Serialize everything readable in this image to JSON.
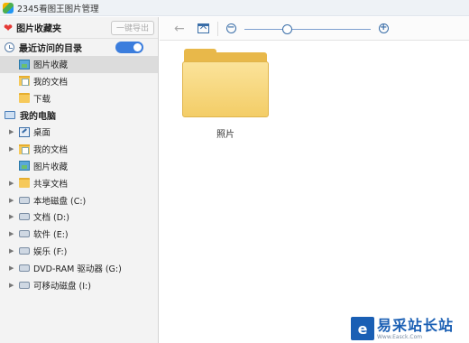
{
  "window": {
    "title": "2345看图王图片管理"
  },
  "sidebar": {
    "favorites_title": "图片收藏夹",
    "export_button": "一键导出",
    "recent_section": "最近访问的目录",
    "recent_toggle_on": true,
    "recent_items": [
      {
        "label": "图片收藏",
        "icon": "pictures-folder-icon",
        "selected": true
      },
      {
        "label": "我的文档",
        "icon": "documents-folder-icon"
      },
      {
        "label": "下载",
        "icon": "folder-icon"
      }
    ],
    "computer_section": "我的电脑",
    "computer_items": [
      {
        "label": "桌面",
        "icon": "desktop-icon",
        "expandable": true
      },
      {
        "label": "我的文档",
        "icon": "documents-folder-icon",
        "expandable": true
      },
      {
        "label": "图片收藏",
        "icon": "pictures-folder-icon",
        "expandable": false
      },
      {
        "label": "共享文档",
        "icon": "folder-icon",
        "expandable": true
      },
      {
        "label": "本地磁盘 (C:)",
        "icon": "drive-icon",
        "expandable": true
      },
      {
        "label": "文档 (D:)",
        "icon": "drive-icon",
        "expandable": true
      },
      {
        "label": "软件 (E:)",
        "icon": "drive-icon",
        "expandable": true
      },
      {
        "label": "娱乐 (F:)",
        "icon": "drive-icon",
        "expandable": true
      },
      {
        "label": "DVD-RAM 驱动器 (G:)",
        "icon": "dvd-drive-icon",
        "expandable": true
      },
      {
        "label": "可移动磁盘 (I:)",
        "icon": "drive-icon",
        "expandable": true
      }
    ]
  },
  "toolbar": {
    "back_icon": "back-arrow-icon",
    "up_icon": "up-folder-icon",
    "zoom_out": "−",
    "zoom_in": "+",
    "zoom_level": 0.33
  },
  "main": {
    "folders": [
      {
        "name": "照片"
      }
    ]
  },
  "watermark": {
    "logo_text": "e",
    "name": "易采站长站",
    "url": "Www.Easck.Com"
  },
  "colors": {
    "accent": "#3b7ddd",
    "folder": "#f3cd67",
    "heart": "#e53935"
  }
}
